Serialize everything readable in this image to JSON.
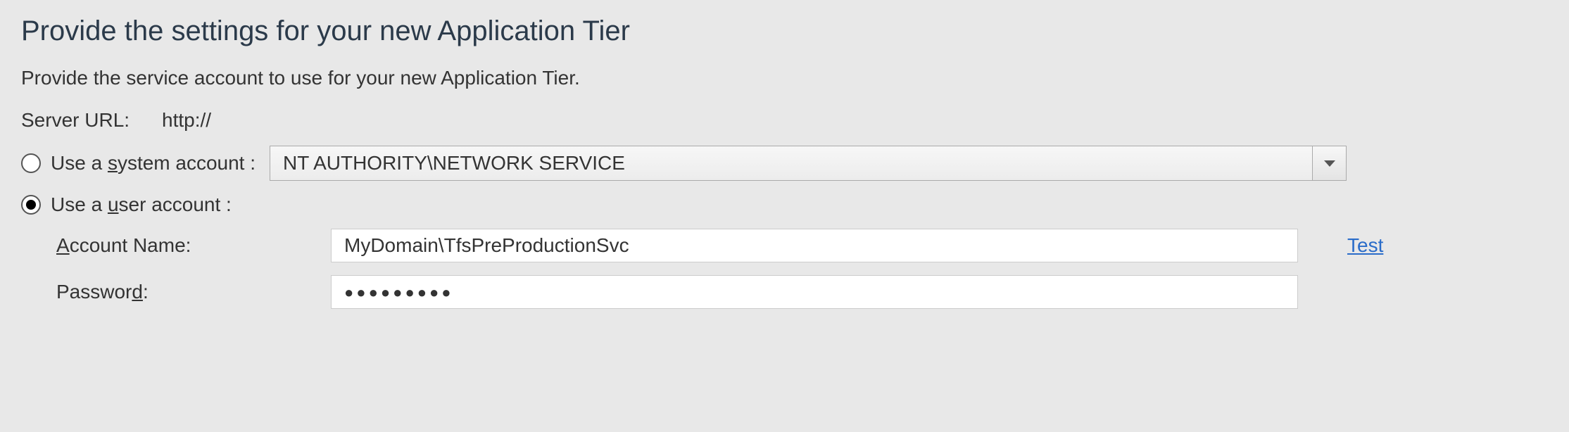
{
  "title": "Provide the settings for your new Application Tier",
  "subtitle": "Provide the service account to use for your new Application Tier.",
  "server_url": {
    "label": "Server URL:",
    "value": "http://"
  },
  "account_choice": {
    "system": {
      "label_pre": "Use a ",
      "label_u": "s",
      "label_post": "ystem account :",
      "selected": false,
      "value": "NT AUTHORITY\\NETWORK SERVICE"
    },
    "user": {
      "label_pre": "Use a ",
      "label_u": "u",
      "label_post": "ser account :",
      "selected": true
    }
  },
  "user_account": {
    "name_label_u": "A",
    "name_label_post": "ccount Name:",
    "name_value": "MyDomain\\TfsPreProductionSvc",
    "password_label_pre": "Passwor",
    "password_label_u": "d",
    "password_label_post": ":",
    "password_mask": "●●●●●●●●●"
  },
  "test_link": "Test"
}
